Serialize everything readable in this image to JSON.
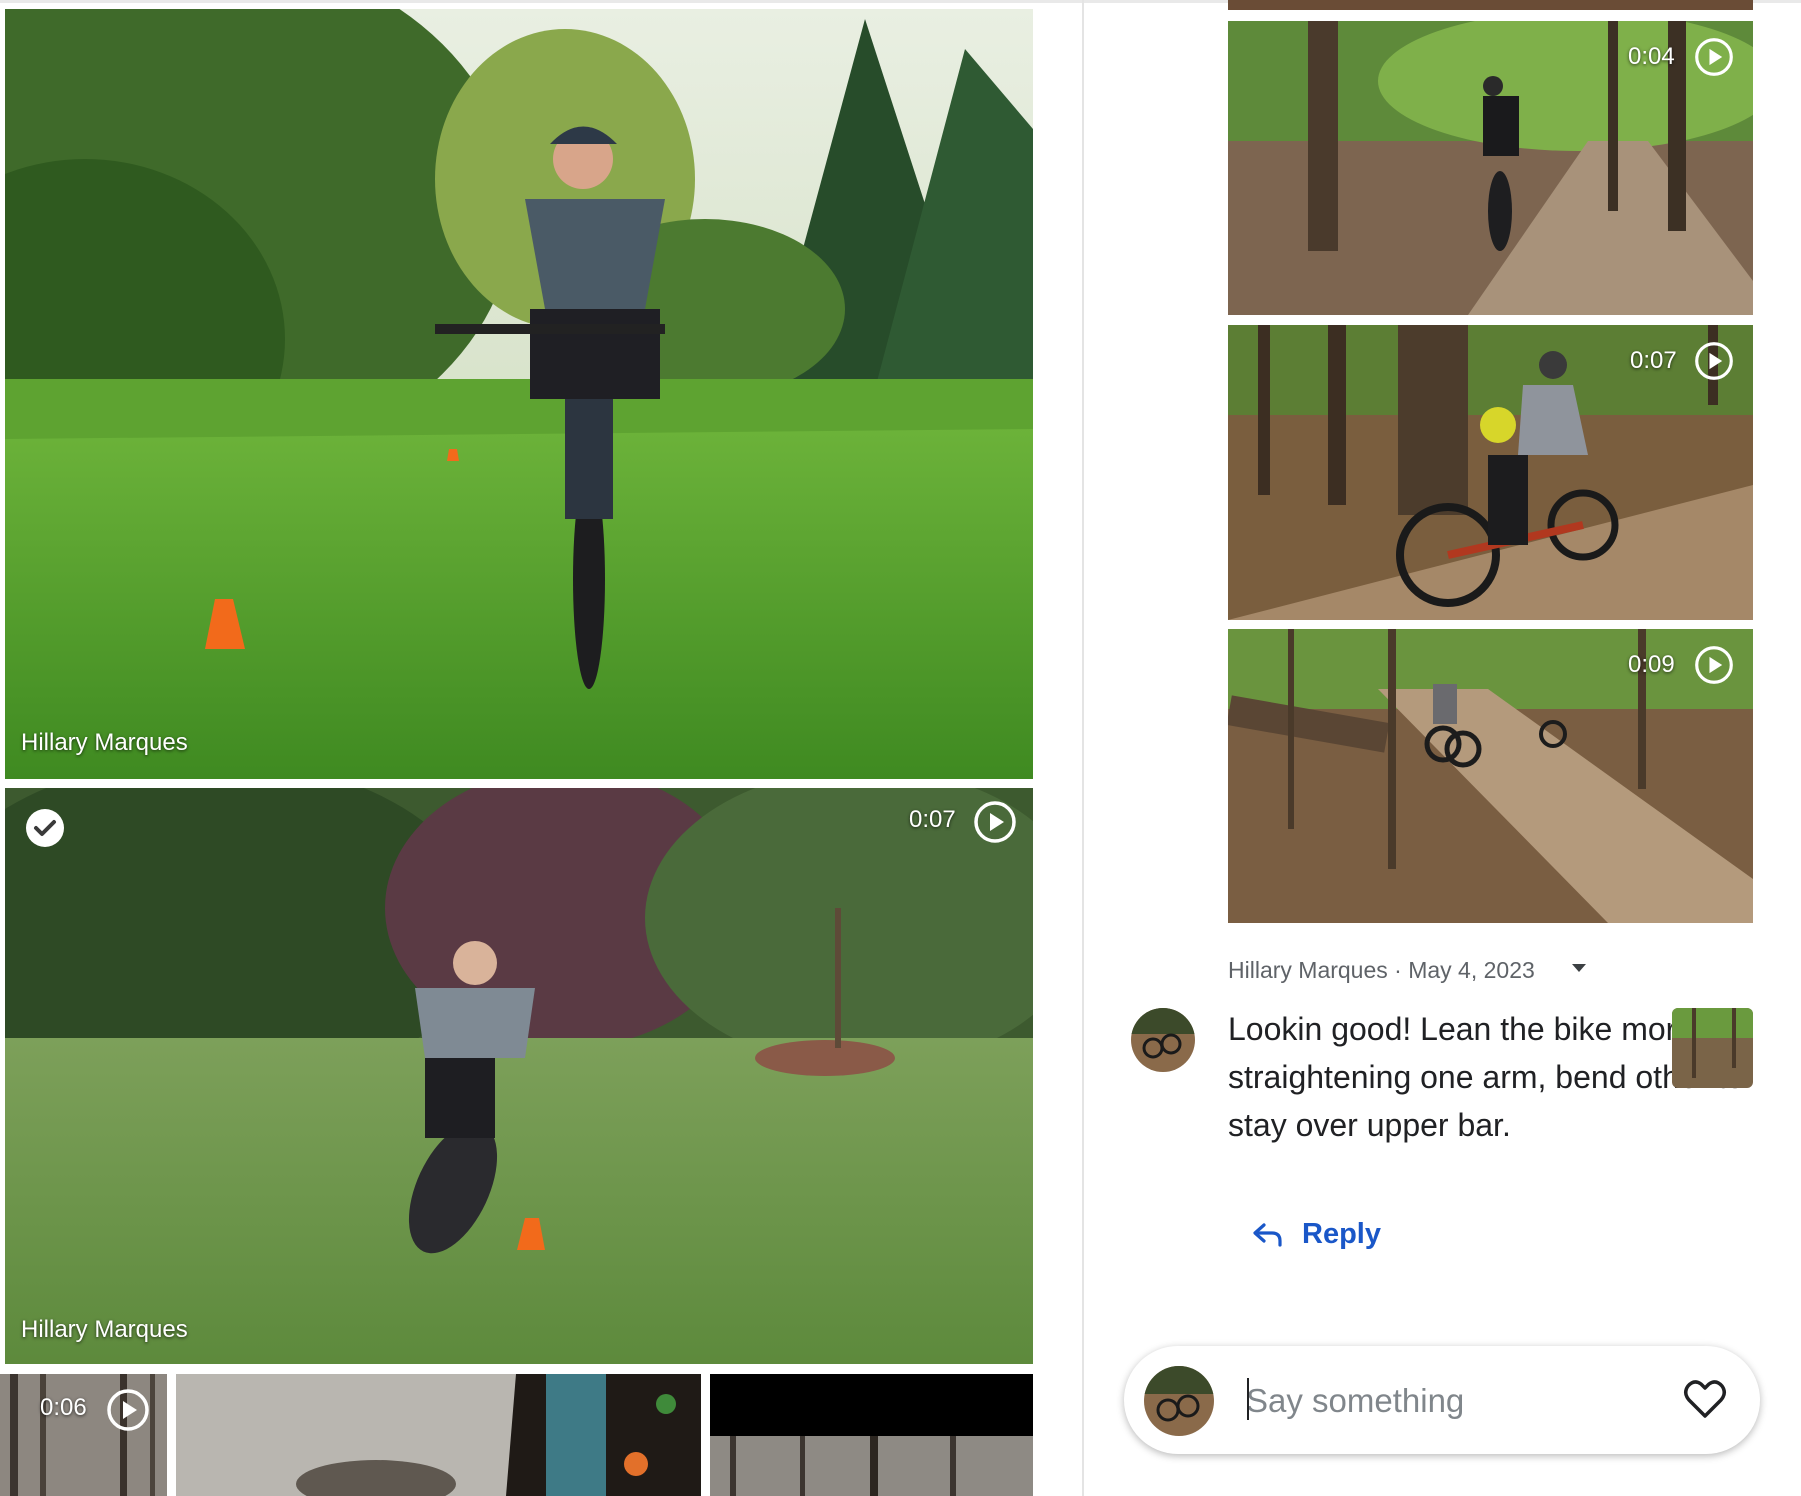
{
  "left_column": {
    "photo1": {
      "owner": "Hillary Marques"
    },
    "video1": {
      "owner": "Hillary Marques",
      "duration": "0:07",
      "selected": true
    },
    "bottom_strip": [
      {
        "duration": "0:06"
      },
      {},
      {}
    ]
  },
  "right_column": {
    "videos": [
      {
        "duration": "0:04"
      },
      {
        "duration": "0:07"
      },
      {
        "duration": "0:09"
      }
    ]
  },
  "comment": {
    "author": "Hillary Marques",
    "separator": "·",
    "date": "May 4, 2023",
    "text": "Lookin good!  Lean the bike more by straightening one arm, bend other to stay over upper bar.",
    "reply_label": "Reply"
  },
  "composer": {
    "placeholder": "Say something"
  },
  "icons": {
    "play": "play-circle-icon",
    "check": "check-circle-icon",
    "caret": "caret-down-icon",
    "reply": "reply-arrow-icon",
    "heart": "heart-outline-icon"
  },
  "colors": {
    "link": "#1a57c8",
    "meta_text": "#5f6368",
    "body_text": "#202124",
    "grass": "#4e9a2c",
    "forest": "#5a4a34"
  }
}
